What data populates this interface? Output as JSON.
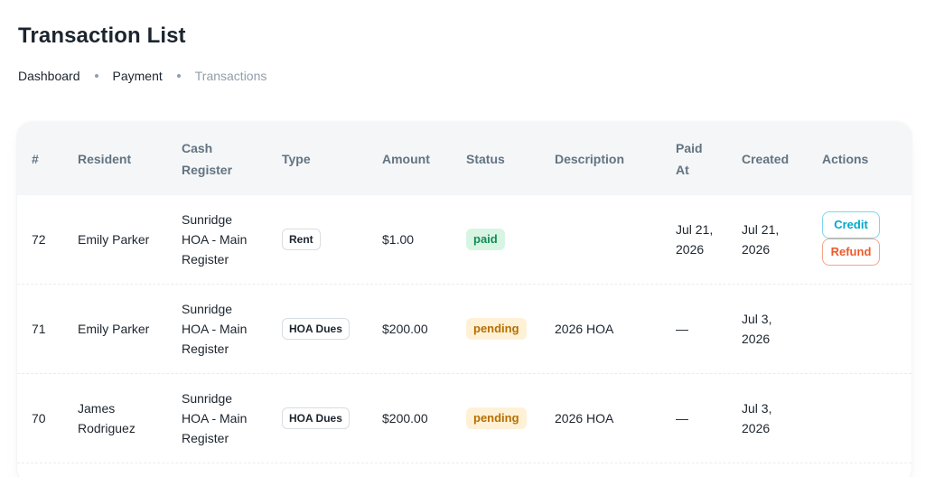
{
  "page": {
    "title": "Transaction List"
  },
  "breadcrumb": [
    {
      "label": "Dashboard"
    },
    {
      "label": "Payment"
    },
    {
      "label": "Transactions"
    }
  ],
  "table": {
    "headers": {
      "id": "#",
      "resident": "Resident",
      "cash_register_1": "Cash",
      "cash_register_2": "Register",
      "type": "Type",
      "amount": "Amount",
      "status": "Status",
      "description": "Description",
      "paid_at_1": "Paid",
      "paid_at_2": "At",
      "created": "Created",
      "actions": "Actions"
    },
    "rows": [
      {
        "id": "72",
        "resident_1": "Emily Parker",
        "resident_2": "",
        "register_1": "Sunridge",
        "register_2": "HOA - Main",
        "register_3": "Register",
        "type": "Rent",
        "amount": "$1.00",
        "status": "paid",
        "description": "",
        "paid_at_1": "Jul 21,",
        "paid_at_2": "2026",
        "created_1": "Jul 21,",
        "created_2": "2026",
        "credit_label": "Credit",
        "refund_label": "Refund"
      },
      {
        "id": "71",
        "resident_1": "Emily Parker",
        "resident_2": "",
        "register_1": "Sunridge",
        "register_2": "HOA - Main",
        "register_3": "Register",
        "type": "HOA Dues",
        "amount": "$200.00",
        "status": "pending",
        "description": "2026 HOA",
        "paid_at_1": "—",
        "paid_at_2": "",
        "created_1": "Jul 3,",
        "created_2": "2026"
      },
      {
        "id": "70",
        "resident_1": "James",
        "resident_2": "Rodriguez",
        "register_1": "Sunridge",
        "register_2": "HOA - Main",
        "register_3": "Register",
        "type": "HOA Dues",
        "amount": "$200.00",
        "status": "pending",
        "description": "2026 HOA",
        "paid_at_1": "—",
        "paid_at_2": "",
        "created_1": "Jul 3,",
        "created_2": "2026"
      }
    ]
  },
  "colors": {
    "paid_bg": "#d8f5e4",
    "paid_text": "#118d57",
    "pending_bg": "#fff1d6",
    "pending_text": "#b76e00",
    "credit": "#00a7cc",
    "refund": "#ee5a2a"
  }
}
